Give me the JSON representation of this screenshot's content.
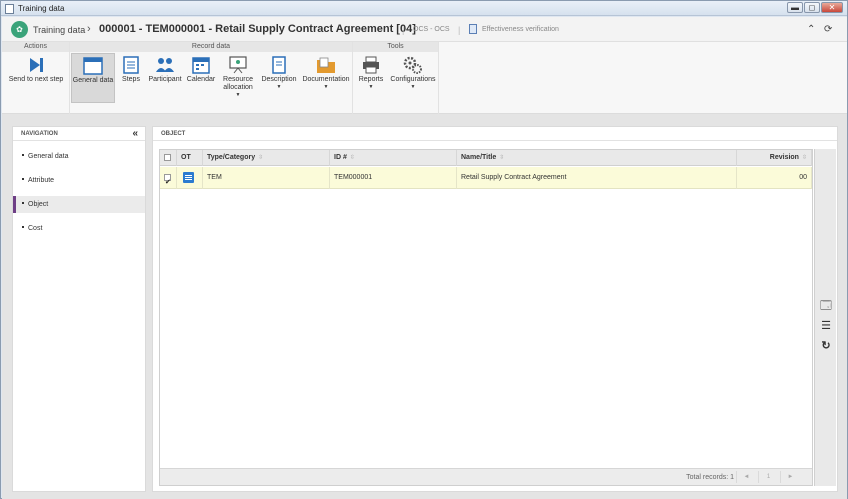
{
  "window": {
    "title": "Training data",
    "minimize": "▬",
    "maximize": "◻",
    "close": "✕"
  },
  "header": {
    "breadcrumb": "Training data",
    "separator": "›",
    "doc_title": "000001 - TEM000001 - Retail Supply Contract Agreement [04]",
    "subtitle": "OCS - OCS",
    "link": "Effectiveness verification",
    "collapse_icon": "double-chevron-up-icon",
    "refresh_icon": "refresh-icon"
  },
  "ribbon": {
    "groups": [
      {
        "label": "Actions"
      },
      {
        "label": "Record data"
      },
      {
        "label": "Tools"
      }
    ],
    "buttons": [
      {
        "label": "Send to next step",
        "icon": "send-next-icon"
      },
      {
        "label": "General data",
        "icon": "window-icon",
        "active": true
      },
      {
        "label": "Steps",
        "icon": "steps-icon"
      },
      {
        "label": "Participant",
        "icon": "participants-icon"
      },
      {
        "label": "Calendar",
        "icon": "calendar-icon"
      },
      {
        "label": "Resource",
        "label2": "allocation",
        "icon": "presentation-icon"
      },
      {
        "label": "Description",
        "icon": "document-icon"
      },
      {
        "label": "Documentation",
        "icon": "folder-icon"
      },
      {
        "label": "Reports",
        "icon": "printer-icon"
      },
      {
        "label": "Configurations",
        "icon": "gears-icon"
      }
    ],
    "caret": "▼"
  },
  "nav": {
    "title": "NAVIGATION",
    "collapse": "«",
    "items": [
      {
        "label": "General data"
      },
      {
        "label": "Attribute"
      },
      {
        "label": "Object",
        "selected": true
      },
      {
        "label": "Cost"
      }
    ]
  },
  "panel": {
    "title": "OBJECT",
    "columns": [
      "OT",
      "Type/Category",
      "ID #",
      "Name/Title",
      "Revision"
    ],
    "sort_glyph": "⇳",
    "rows": [
      {
        "checked": true,
        "type": "TEM",
        "id": "TEM000001",
        "name": "Retail Supply Contract Agreement",
        "revision": "00"
      }
    ],
    "total": "Total records: 1",
    "pager": {
      "prev": "◄",
      "page": "1",
      "next": "►"
    }
  },
  "colors": {
    "accent": "#6e3f86",
    "row_highlight": "#fbfbd9",
    "logo": "#3aa37a"
  }
}
